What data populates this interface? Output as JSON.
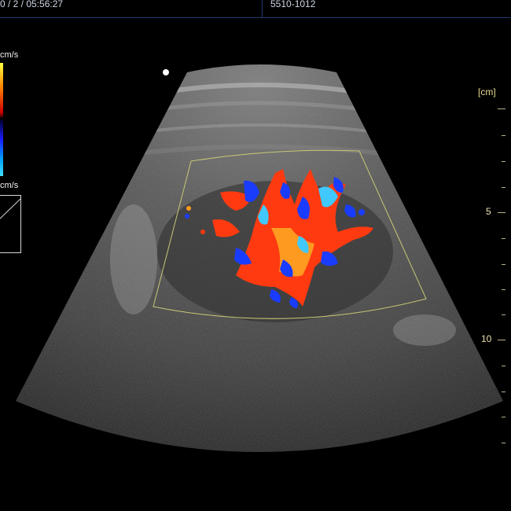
{
  "header": {
    "patient_field": "0 / 2 / 05:56:27",
    "exam_field": "5510-1012"
  },
  "velocity_scale": {
    "top_unit": "cm/s",
    "bottom_unit": "cm/s",
    "positive_colors": [
      "#ffff40",
      "#ff8000",
      "#cc0000"
    ],
    "negative_colors": [
      "#1a1aff",
      "#00a0ff",
      "#40e0ff"
    ]
  },
  "depth_scale": {
    "unit": "[cm]",
    "labels": [
      "5",
      "10"
    ]
  },
  "colors": {
    "background": "#000000",
    "roi_box": "#c8c878",
    "flow_red": "#ff3a10",
    "flow_orange": "#ff9a20",
    "flow_blue": "#1a3cff",
    "flow_cyan": "#40c8ff"
  }
}
